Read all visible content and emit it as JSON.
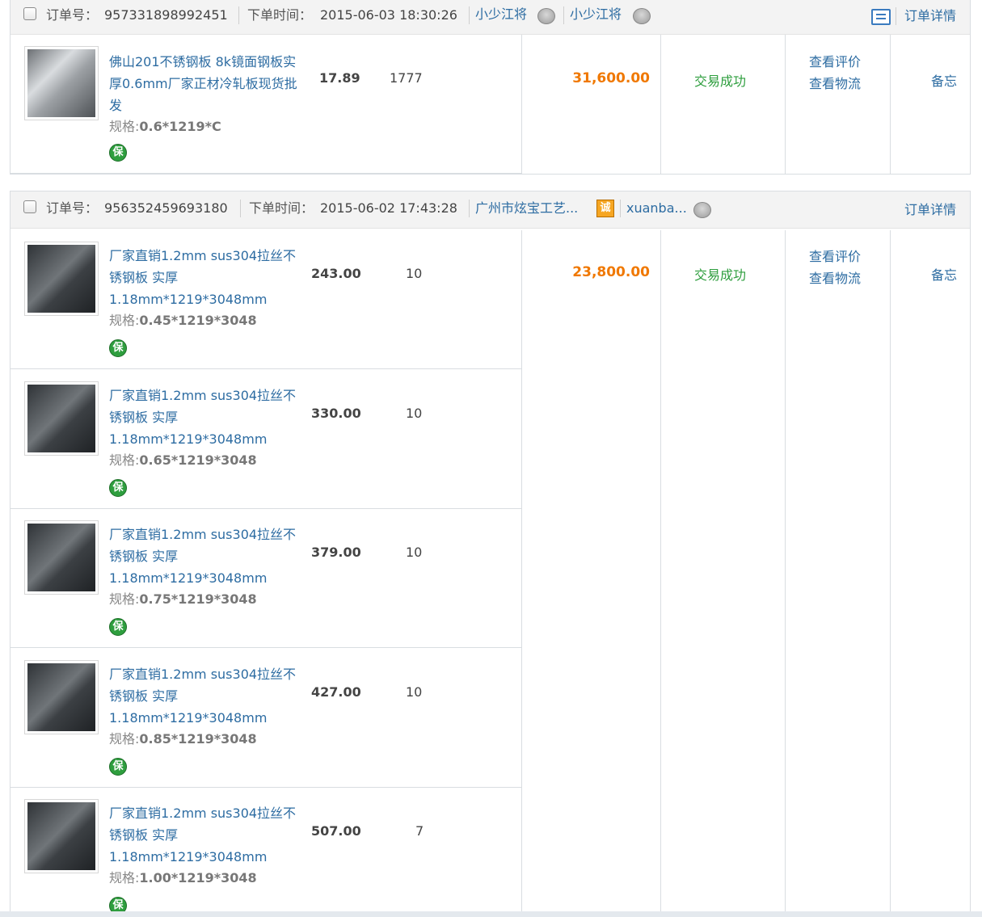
{
  "orders": [
    {
      "order_no_label": "订单号：",
      "order_no": "957331898992451",
      "time_label": "下单时间：",
      "time": "2015-06-03 18:30:26",
      "shop": "小少江将",
      "buyer": "小少江将",
      "detail_label": "订单详情",
      "items": [
        {
          "title": "佛山201不锈钢板 8k镜面钢板实厚0.6mm厂家正材冷轧板现货批发",
          "spec_label": "规格:",
          "spec": "0.6*1219*C",
          "price": "17.89",
          "qty": "1777",
          "bao": "保"
        }
      ],
      "amount": "31,600.00",
      "status": "交易成功",
      "actions": [
        "查看评价",
        "查看物流"
      ],
      "memo": "备忘"
    },
    {
      "order_no_label": "订单号：",
      "order_no": "956352459693180",
      "time_label": "下单时间：",
      "time": "2015-06-02 17:43:28",
      "shop": "广州市炫宝工艺...",
      "cheng_badge": "诚",
      "buyer": "xuanba...",
      "detail_label": "订单详情",
      "items": [
        {
          "title": "厂家直销1.2mm sus304拉丝不锈钢板 实厚1.18mm*1219*3048mm",
          "spec_label": "规格:",
          "spec": "0.45*1219*3048",
          "price": "243.00",
          "qty": "10",
          "bao": "保"
        },
        {
          "title": "厂家直销1.2mm sus304拉丝不锈钢板 实厚1.18mm*1219*3048mm",
          "spec_label": "规格:",
          "spec": "0.65*1219*3048",
          "price": "330.00",
          "qty": "10",
          "bao": "保"
        },
        {
          "title": "厂家直销1.2mm sus304拉丝不锈钢板 实厚1.18mm*1219*3048mm",
          "spec_label": "规格:",
          "spec": "0.75*1219*3048",
          "price": "379.00",
          "qty": "10",
          "bao": "保"
        },
        {
          "title": "厂家直销1.2mm sus304拉丝不锈钢板 实厚1.18mm*1219*3048mm",
          "spec_label": "规格:",
          "spec": "0.85*1219*3048",
          "price": "427.00",
          "qty": "10",
          "bao": "保"
        },
        {
          "title": "厂家直销1.2mm sus304拉丝不锈钢板 实厚1.18mm*1219*3048mm",
          "spec_label": "规格:",
          "spec": "1.00*1219*3048",
          "price": "507.00",
          "qty": "7",
          "bao": "保"
        }
      ],
      "amount": "23,800.00",
      "status": "交易成功",
      "actions": [
        "查看评价",
        "查看物流"
      ],
      "memo": "备忘"
    }
  ],
  "colors": {
    "link": "#2d6ca2",
    "amount": "#f07800",
    "status": "#2e9e3e",
    "header_bg": "#f3f3f3",
    "border": "#d9dde1"
  },
  "icons": {
    "checkbox": "checkbox-icon",
    "wangwang": "wangwang-chat-icon",
    "message": "message-icon",
    "bao": "bao-guarantee-icon",
    "cheng": "cheng-xin-badge-icon"
  }
}
